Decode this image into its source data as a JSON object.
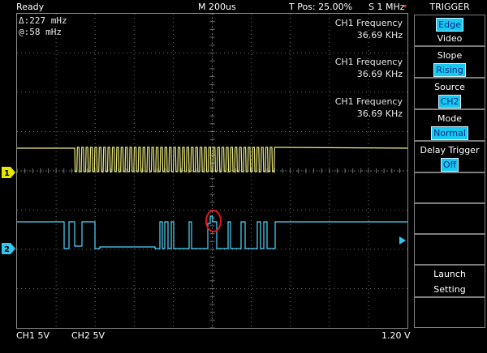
{
  "topbar": {
    "status": "Ready",
    "timebase": "M 200us",
    "trigger_pos": "T Pos: 25.00%",
    "sample_rate": "S 1 MHz"
  },
  "cursors": {
    "delta": "Δ:227 mHz",
    "at": "@:58 mHz"
  },
  "measurements": [
    {
      "label": "CH1 Frequency",
      "value": "36.69 KHz"
    },
    {
      "label": "CH1 Frequency",
      "value": "36.69 KHz"
    },
    {
      "label": "CH1 Frequency",
      "value": "36.69 KHz"
    }
  ],
  "channel_markers": {
    "ch1": "1",
    "ch2": "2"
  },
  "bottombar": {
    "ch1_scale": "CH1  5V",
    "ch2_scale": "CH2  5V",
    "trigger_level": "1.20 V"
  },
  "menu": {
    "title": "TRIGGER",
    "type_selected": "Edge",
    "type_alt": "Video",
    "slope_label": "Slope",
    "slope_value": "Rising",
    "source_label": "Source",
    "source_value": "CH2",
    "mode_label": "Mode",
    "mode_value": "Normal",
    "delay_label": "Delay Trigger",
    "delay_value": "Off",
    "launch_label_1": "Launch",
    "launch_label_2": "Setting"
  },
  "colors": {
    "ch1_trace": "#ecec80",
    "ch2_trace": "#4fd8ff",
    "grid": "#6f6f6f",
    "highlight": "#e0161d",
    "menu_value_bg": "#17c9f0"
  }
}
